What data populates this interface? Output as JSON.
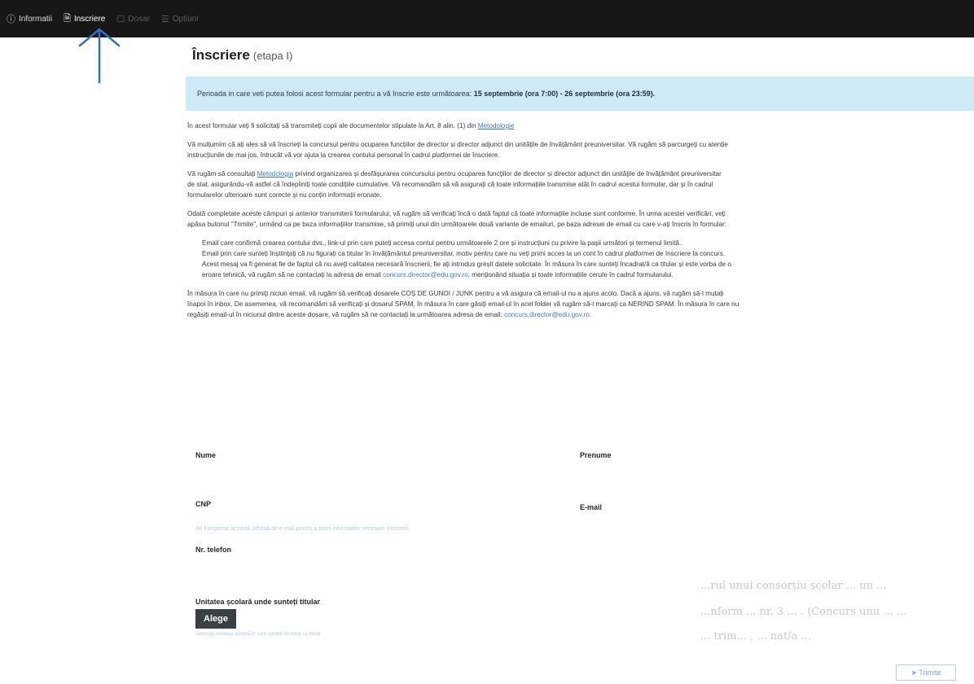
{
  "nav": {
    "items": [
      {
        "icon": "ⓘ",
        "label": "Informatii"
      },
      {
        "icon": "🗎",
        "label": "Inscriere"
      },
      {
        "icon": "☐",
        "label": "Dosar"
      },
      {
        "icon": "☰",
        "label": "Optiuni"
      }
    ]
  },
  "page": {
    "title": "Înscriere",
    "subtitle": "(etapa I)",
    "banner_text": "Perioada in care veti putea folosi acest formular pentru a vă înscrie este următoarea:",
    "banner_period": "15 septembrie (ora 7:00) - 26 septembrie (ora 23:59)."
  },
  "content": {
    "p1_text": "În acest formular veți fi solicitați să transmiteți copii ale documentelor stipulate la Art. 8 alin. (1) din",
    "p1_link": "Metodologie",
    "p2_line1": "Vă mulțumim că ați ales să vă înscrieți la concursul pentru ocuparea funcțiilor de director și director adjunct din unitățile de învățământ preuniversitar. Vă rugăm să parcurgeți cu atenție",
    "p2_line2": "instrucțiunile de mai jos, întrucât vă vor ajuta la crearea contului personal în cadrul platformei de înscriere.",
    "p3_pre": "Vă rugăm să consultați",
    "p3_link": "Metodologia",
    "p3_line1_rest": "privind organizarea și desfășurarea concursului pentru ocuparea funcțiilor de director și director adjunct din unitățile de învățământ preuniversitar",
    "p3_line2": "de stat, asigurându-vă astfel că îndepliniți toate condițiile cumulative. Vă recomandăm să vă asigurați că toate informațiile transmise atât în cadrul acestui formular, dar și în cadrul",
    "p3_line3": "formularelor ulterioare sunt corecte și nu conțin informații eronate.",
    "p4_line1": "Odată completate aceste câmpuri și anterior transmiterii formularului, vă rugăm să verificați încă o dată faptul că toate informațiile incluse sunt conforme. În urma acestei verificări, veți",
    "p4_line2": "apăsa butonul \"Trimite\", urmând ca pe baza informațiilor transmise, să primiți unul din următoarele două variante de emailuri, pe baza adresei de email cu care v-ați înscris în formular:",
    "li1": "Email care confirmă crearea contului dvs., link-ul prin care puteți accesa contul pentru următoarele 2 ore și instrucțiuni cu privire la pașii următori și termenul limită.",
    "li2_line1": "Email prin care sunteți înștiințați că nu figurați ca titular în învățământul preuniversitar, motiv pentru care nu veți primi acces la un cont în cadrul platformei de înscriere la concurs.",
    "li2_line2": "Acest mesaj va fi generat fie de faptul că nu aveți calitatea necesară înscrierii, fie ați introdus greșit datele solicitate. În măsura în care sunteți încadrat/ă ca titular și este vorba de o",
    "li2_line3_pre": "eroare tehnică, vă rugăm să ne contactați la adresa de email",
    "li2_email": "concurs.director@edu.gov.ro",
    "li2_line3_post": ", menționând situația și toate informațiile cerute în cadrul formularului.",
    "p5_line1": "În măsura în care nu primiți niciun email, vă rugăm să verificați dosarele COȘ DE GUNOI / JUNK pentru a vă asigura că email-ul nu a ajuns acolo. Dacă a ajuns, vă rugăm să-l mutați",
    "p5_line2": "înapoi în inbox. De asemenea, vă recomandăm să verificați și dosarul SPAM, în măsura în care găsiți email-ul în acel folder vă rugăm să-l marcați ca NERIND SPAM. În măsura în care nu",
    "p5_line3_pre": "regăsiți email-ul în niciunul dintre aceste dosare, vă rugăm să ne contactați la următoarea adresa de email:",
    "p5_email": "concurs.director@edu.gov.ro."
  },
  "form": {
    "nume_label": "Nume",
    "prenume_label": "Prenume",
    "cnp_label": "CNP",
    "email_label": "E-mail",
    "email_hint": "Ati înregistrat această adresă de e-mail pentru a primi informațiile necesare înscrierii.",
    "telefon_label": "Nr. telefon",
    "unitate_label": "Unitatea școlară unde sunteți titular",
    "alege_label": "Alege",
    "unitate_hint": "Selectați unitatea școlară în care sunteți încadrat ca titular",
    "trimite_label": "➤ Trimite"
  },
  "bleed_text": {
    "line1": "...rul unui consorțiu școlar ... un ...",
    "line2": "...nform ... nr. 3 ... . (Concurs unu ... ...",
    "line3": "... trim... , ... nat/a ..."
  }
}
